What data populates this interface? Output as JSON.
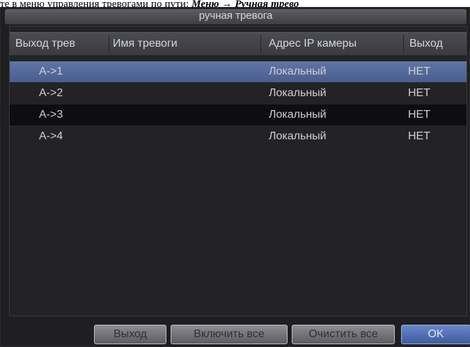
{
  "caption": {
    "text": "те в меню управления тревогами по пути: ",
    "path": "Меню → Ручная трево"
  },
  "dialog": {
    "title": "ручная тревога"
  },
  "table": {
    "headers": {
      "output": "Выход трев",
      "name": "Имя тревоги",
      "camera_ip": "Адрес IP камеры",
      "action": "Выход"
    },
    "rows": [
      {
        "output": "A->1",
        "name": "",
        "camera_ip": "Локальный",
        "action": "НЕТ",
        "state": "selected"
      },
      {
        "output": "A->2",
        "name": "",
        "camera_ip": "Локальный",
        "action": "НЕТ",
        "state": "normal"
      },
      {
        "output": "A->3",
        "name": "",
        "camera_ip": "Локальный",
        "action": "НЕТ",
        "state": "dark"
      },
      {
        "output": "A->4",
        "name": "",
        "camera_ip": "Локальный",
        "action": "НЕТ",
        "state": "normal"
      }
    ]
  },
  "buttons": {
    "exit": "Выход",
    "enable_all": "Включить все",
    "clear_all": "Очистить все",
    "ok": "OK"
  },
  "colors": {
    "selected_row": "#5569a0",
    "panel_bg": "#1f1f22",
    "ok_button": "#4d6aae"
  }
}
